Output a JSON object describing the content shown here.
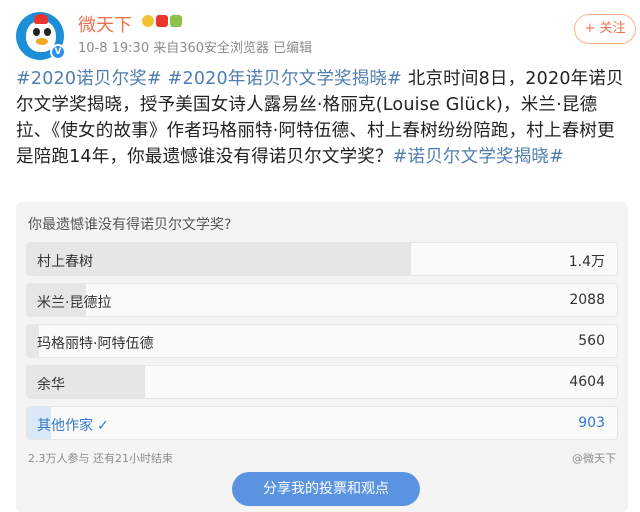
{
  "header": {
    "username": "微天下",
    "meta": "10-8 19:30  来自360安全浏览器  已编辑",
    "follow_label": "+ 关注",
    "badge_icons": [
      "vip-sun-icon",
      "china-flag-icon",
      "medal-icon"
    ]
  },
  "post": {
    "tag1": "#2020诺贝尔奖#",
    "tag2": "#2020年诺贝尔文学奖揭晓#",
    "body": " 北京时间8日，2020年诺贝尔文学奖揭晓，授予美国女诗人露易丝·格丽克(Louise Glück)，米兰·昆德拉、《使女的故事》作者玛格丽特·阿特伍德、村上春树纷纷陪跑，村上春树更是陪跑14年，你最遗憾谁没有得诺贝尔文学奖？",
    "tag3": "#诺贝尔文学奖揭晓#"
  },
  "poll": {
    "question": "你最遗憾谁没有得诺贝尔文学奖?",
    "options": [
      {
        "label": "村上春树",
        "count": "1.4万",
        "share": 0.65
      },
      {
        "label": "米兰·昆德拉",
        "count": "2088",
        "share": 0.1
      },
      {
        "label": "玛格丽特·阿特伍德",
        "count": "560",
        "share": 0.02
      },
      {
        "label": "余华",
        "count": "4604",
        "share": 0.2
      },
      {
        "label": "其他作家",
        "count": "903",
        "share": 0.04,
        "selected": true
      }
    ],
    "participants": "2.3万人参与  还有21小时结束",
    "source": "@微天下",
    "share_label": "分享我的投票和观点"
  },
  "colors": {
    "accent_blue": "#5a93e0",
    "username_orange": "#eb7350",
    "tag_blue": "#507daf"
  }
}
